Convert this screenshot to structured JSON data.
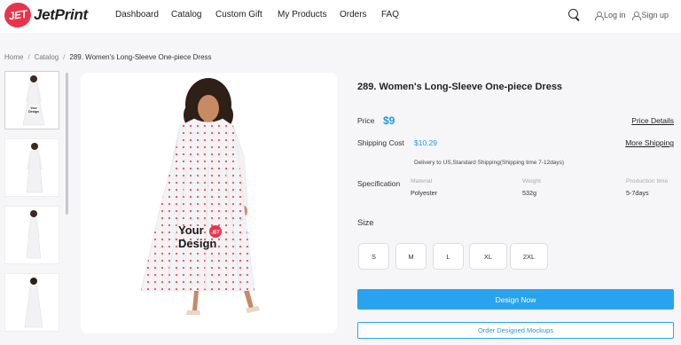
{
  "header": {
    "logo_badge": "JET",
    "logo_text": "JetPrint",
    "nav": [
      "Dashboard",
      "Catalog",
      "Custom Gift",
      "My Products",
      "Orders",
      "FAQ"
    ],
    "login_label": "Log in",
    "signup_label": "Sign up"
  },
  "breadcrumb": {
    "items": [
      "Home",
      "Catalog"
    ],
    "separator": "/",
    "current": "289. Women's Long-Sleeve One-piece Dress"
  },
  "product": {
    "title": "289. Women's Long-Sleeve One-piece Dress",
    "price_label": "Price",
    "price": "$9",
    "price_details_link": "Price Details",
    "shipping_label": "Shipping Cost",
    "shipping_cost": "$10.29",
    "more_shipping_link": "More Shipping",
    "delivery_note": "Delivery to US,Standard Shipping(Shipping time 7-12days)",
    "spec_label": "Specification",
    "specs": [
      {
        "key": "Material",
        "value": "Polyester"
      },
      {
        "key": "Weight",
        "value": "532g"
      },
      {
        "key": "Production time",
        "value": "5-7days"
      }
    ],
    "size_label": "Size",
    "sizes": [
      "S",
      "M",
      "L",
      "XL",
      "2XL"
    ],
    "design_button": "Design Now",
    "mockup_button": "Order Designed Mockups"
  },
  "image": {
    "overlay_line1": "Your",
    "overlay_line2": "Design",
    "badge": "JET"
  },
  "colors": {
    "accent": "#2aa3ee",
    "brand": "#e8344a",
    "dot": "#f04a5c"
  }
}
